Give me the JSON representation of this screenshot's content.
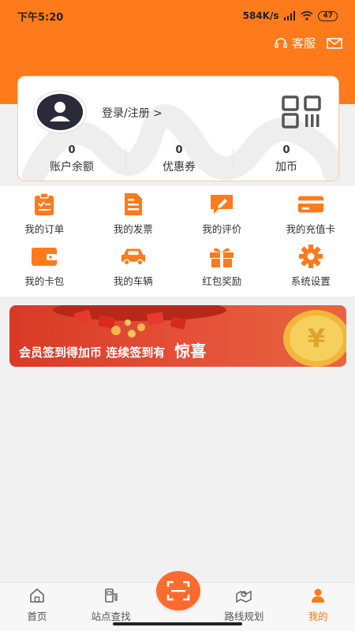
{
  "status_bar": {
    "time": "下午5:20",
    "network_speed": "584K/s",
    "battery": "47"
  },
  "header": {
    "service_label": "客服"
  },
  "profile": {
    "login_text": "登录/注册 >",
    "stats": [
      {
        "value": "0",
        "label": "账户余额"
      },
      {
        "value": "0",
        "label": "优惠券"
      },
      {
        "value": "0",
        "label": "加币"
      }
    ]
  },
  "menu": [
    {
      "label": "我的订单",
      "icon": "clipboard-icon"
    },
    {
      "label": "我的发票",
      "icon": "invoice-icon"
    },
    {
      "label": "我的评价",
      "icon": "review-icon"
    },
    {
      "label": "我的充值卡",
      "icon": "card-icon"
    },
    {
      "label": "我的卡包",
      "icon": "wallet-icon"
    },
    {
      "label": "我的车辆",
      "icon": "car-icon"
    },
    {
      "label": "红包奖励",
      "icon": "gift-icon"
    },
    {
      "label": "系统设置",
      "icon": "gear-icon"
    }
  ],
  "banner": {
    "text": "会员签到得加币 连续签到有",
    "highlight": "惊喜"
  },
  "tabbar": [
    {
      "label": "首页",
      "icon": "home-icon"
    },
    {
      "label": "站点查找",
      "icon": "station-icon"
    },
    {
      "label": "路线规划",
      "icon": "route-icon"
    },
    {
      "label": "我的",
      "icon": "user-icon",
      "active": true
    }
  ],
  "colors": {
    "accent": "#ff7a1a",
    "banner": "#d83a26"
  }
}
